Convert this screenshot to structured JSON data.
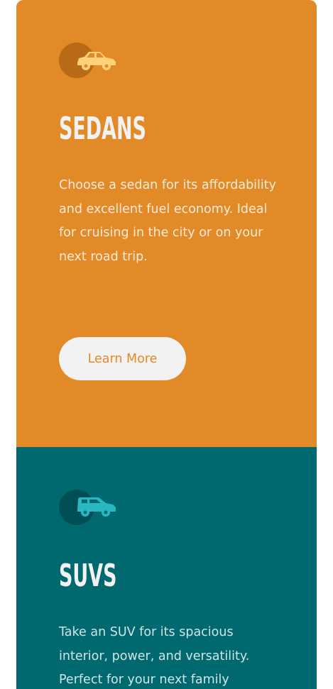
{
  "cards": [
    {
      "icon": "sedan-car-icon",
      "title": "SEDANS",
      "text": "Choose a sedan for its affordability and excellent fuel economy. Ideal for cruising in the city or on your next road trip.",
      "button_label": "Learn More"
    },
    {
      "icon": "suv-car-icon",
      "title": "SUVS",
      "text": "Take an SUV for its spacious interior, power, and versatility. Perfect for your next family"
    }
  ],
  "colors": {
    "sedan_bg": "#e28a27",
    "suv_bg": "#006970",
    "button_bg": "#f2f2f2",
    "sedan_icon": "#ffd17a",
    "suv_icon": "#2ab7c4"
  }
}
